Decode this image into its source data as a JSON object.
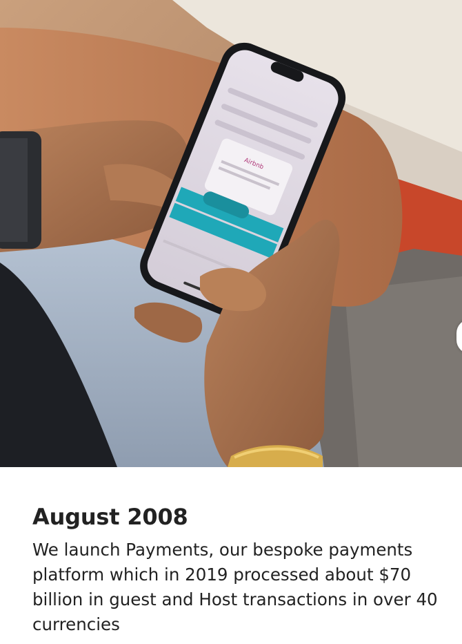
{
  "milestone": {
    "title": "August 2008",
    "description": "We launch Payments, our bespoke payments platform which in 2019 processed about $70 billion in guest and Host transactions in over 40 currencies"
  },
  "photo": {
    "alt": "Person holding a smartphone showing the Airbnb app",
    "dialog_title": "Airbnb"
  },
  "colors": {
    "accent": "#1fa8b8",
    "text": "#222222",
    "background": "#ffffff"
  }
}
